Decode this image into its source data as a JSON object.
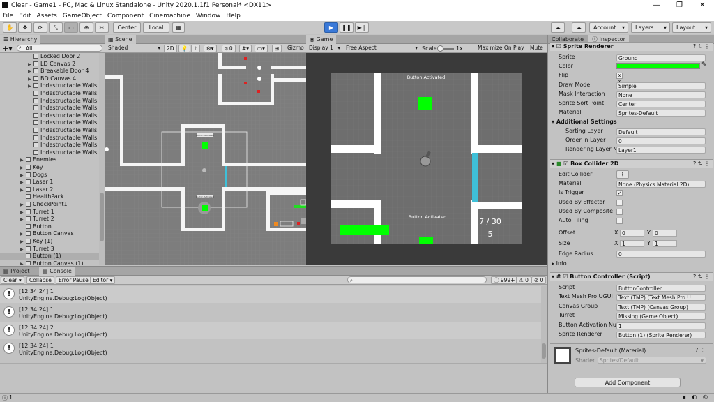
{
  "window": {
    "title": "Clear - Game1 - PC, Mac & Linux Standalone - Unity 2020.1.1f1 Personal* <DX11>",
    "buttons": [
      "—",
      "❐",
      "✕"
    ]
  },
  "menu": [
    "File",
    "Edit",
    "Assets",
    "GameObject",
    "Component",
    "Cinemachine",
    "Window",
    "Help"
  ],
  "toolbar": {
    "center": "Center",
    "local": "Local",
    "account": "Account",
    "layers": "Layers",
    "layout": "Layout"
  },
  "hierarchy": {
    "tab": "Hierarchy",
    "search_placeholder": "All",
    "items": [
      {
        "label": "Locked Door 2",
        "indent": 2,
        "expand": false
      },
      {
        "label": "LD Canvas 2",
        "indent": 2,
        "expand": true
      },
      {
        "label": "Breakable Door 4",
        "indent": 2,
        "expand": true
      },
      {
        "label": "BD Canvas 4",
        "indent": 2,
        "expand": true
      },
      {
        "label": "Indestructable Walls",
        "indent": 2,
        "expand": true
      },
      {
        "label": "Indestructable Walls",
        "indent": 2,
        "expand": false
      },
      {
        "label": "Indestructable Walls",
        "indent": 2,
        "expand": false
      },
      {
        "label": "Indestructable Walls",
        "indent": 2,
        "expand": false
      },
      {
        "label": "Indestructable Walls",
        "indent": 2,
        "expand": false
      },
      {
        "label": "Indestructable Walls",
        "indent": 2,
        "expand": false
      },
      {
        "label": "Indestructable Walls",
        "indent": 2,
        "expand": false
      },
      {
        "label": "Indestructable Walls",
        "indent": 2,
        "expand": false
      },
      {
        "label": "Indestructable Walls",
        "indent": 2,
        "expand": false
      },
      {
        "label": "Indestructable Walls",
        "indent": 2,
        "expand": false
      },
      {
        "label": "Enemies",
        "indent": 1,
        "expand": true
      },
      {
        "label": "Key",
        "indent": 1,
        "expand": true
      },
      {
        "label": "Dogs",
        "indent": 1,
        "expand": true
      },
      {
        "label": "Laser 1",
        "indent": 1,
        "expand": true
      },
      {
        "label": "Laser 2",
        "indent": 1,
        "expand": true
      },
      {
        "label": "HealthPack",
        "indent": 1,
        "expand": false
      },
      {
        "label": "CheckPoint1",
        "indent": 1,
        "expand": true
      },
      {
        "label": "Turret 1",
        "indent": 1,
        "expand": true
      },
      {
        "label": "Turret 2",
        "indent": 1,
        "expand": true
      },
      {
        "label": "Button",
        "indent": 1,
        "expand": false
      },
      {
        "label": "Button Canvas",
        "indent": 1,
        "expand": true
      },
      {
        "label": "Key (1)",
        "indent": 1,
        "expand": true
      },
      {
        "label": "Turret 3",
        "indent": 1,
        "expand": true
      },
      {
        "label": "Button (1)",
        "indent": 1,
        "expand": false,
        "selected": true
      },
      {
        "label": "Button Canvas  (1)",
        "indent": 1,
        "expand": true
      }
    ]
  },
  "scene": {
    "tab": "Scene",
    "shading": "Shaded",
    "mode2d": "2D",
    "hidden_count": "0",
    "gizmos": "Gizmo",
    "button_label_1": "Button Activated",
    "button_label_2": "Button Activated"
  },
  "game": {
    "tab": "Game",
    "display": "Display 1",
    "aspect": "Free Aspect",
    "scale_label": "Scale",
    "scale_value": "1x",
    "maximize": "Maximize On Play",
    "mute": "Mute",
    "top_text": "Button Activated",
    "bottom_text": "Button Activated",
    "ammo": "7  /  30",
    "count": "5"
  },
  "inspector": {
    "tabs": [
      "Collaborate",
      "Inspector"
    ],
    "sprite_renderer": {
      "header": "Sprite Renderer",
      "fields": [
        {
          "label": "Sprite",
          "value": "Ground"
        },
        {
          "label": "Color",
          "value": ""
        },
        {
          "label": "Flip",
          "value": "X   Y"
        },
        {
          "label": "Draw Mode",
          "value": "Simple"
        },
        {
          "label": "Mask Interaction",
          "value": "None"
        },
        {
          "label": "Sprite Sort Point",
          "value": "Center"
        },
        {
          "label": "Material",
          "value": "Sprites-Default"
        }
      ],
      "additional": "Additional Settings",
      "additional_fields": [
        {
          "label": "Sorting Layer",
          "value": "Default"
        },
        {
          "label": "Order in Layer",
          "value": "0"
        },
        {
          "label": "Rendering Layer M",
          "value": "Layer1"
        }
      ],
      "color": "#00ff00"
    },
    "box_collider": {
      "header": "Box Collider 2D",
      "fields": [
        {
          "label": "Edit Collider",
          "value": ""
        },
        {
          "label": "Material",
          "value": "None (Physics Material 2D)"
        },
        {
          "label": "Is Trigger",
          "value": "✓"
        },
        {
          "label": "Used By Effector",
          "value": ""
        },
        {
          "label": "Used By Composite",
          "value": ""
        },
        {
          "label": "Auto Tiling",
          "value": ""
        }
      ],
      "offset": {
        "label": "Offset",
        "x": "0",
        "y": "0"
      },
      "size": {
        "label": "Size",
        "x": "1",
        "y": "1"
      },
      "edge": {
        "label": "Edge Radius",
        "value": "0"
      },
      "info": "Info"
    },
    "button_controller": {
      "header": "Button Controller (Script)",
      "fields": [
        {
          "label": "Script",
          "value": "ButtonController"
        },
        {
          "label": "Text Mesh Pro UGUI",
          "value": "Text (TMP) (Text Mesh Pro U"
        },
        {
          "label": "Canvas Group",
          "value": "Text (TMP) (Canvas Group)"
        },
        {
          "label": "Turret",
          "value": "Missing (Game Object)"
        },
        {
          "label": "Button Activation Nu",
          "value": "1"
        },
        {
          "label": "Sprite Renderer",
          "value": "Button (1) (Sprite Renderer)"
        }
      ]
    },
    "material": {
      "name": "Sprites-Default (Material)",
      "shader_label": "Shader",
      "shader": "Sprites/Default"
    },
    "add_component": "Add Component"
  },
  "console": {
    "tabs": [
      "Project",
      "Console"
    ],
    "buttons": [
      "Clear",
      "Collapse",
      "Error Pause",
      "Editor"
    ],
    "counts": [
      "999+",
      "0",
      "0"
    ],
    "logs": [
      {
        "line1": "[12:34:24] 1",
        "line2": "UnityEngine.Debug:Log(Object)"
      },
      {
        "line1": "[12:34:24] 1",
        "line2": "UnityEngine.Debug:Log(Object)"
      },
      {
        "line1": "[12:34:24] 2",
        "line2": "UnityEngine.Debug:Log(Object)"
      },
      {
        "line1": "[12:34:24] 1",
        "line2": "UnityEngine.Debug:Log(Object)"
      }
    ]
  },
  "status": {
    "text": "1"
  }
}
